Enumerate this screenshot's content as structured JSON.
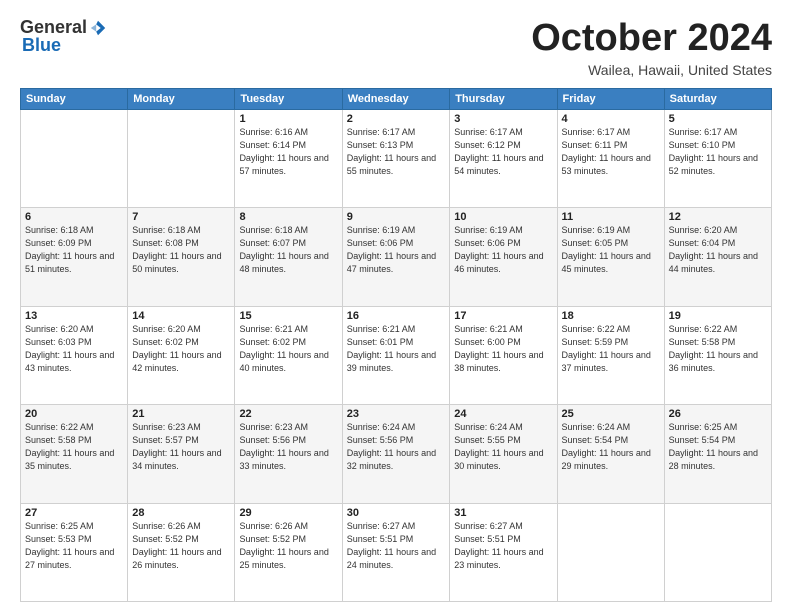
{
  "header": {
    "logo_general": "General",
    "logo_blue": "Blue",
    "month_title": "October 2024",
    "location": "Wailea, Hawaii, United States"
  },
  "calendar": {
    "days_of_week": [
      "Sunday",
      "Monday",
      "Tuesday",
      "Wednesday",
      "Thursday",
      "Friday",
      "Saturday"
    ],
    "weeks": [
      [
        {
          "day": "",
          "sunrise": "",
          "sunset": "",
          "daylight": ""
        },
        {
          "day": "",
          "sunrise": "",
          "sunset": "",
          "daylight": ""
        },
        {
          "day": "1",
          "sunrise": "Sunrise: 6:16 AM",
          "sunset": "Sunset: 6:14 PM",
          "daylight": "Daylight: 11 hours and 57 minutes."
        },
        {
          "day": "2",
          "sunrise": "Sunrise: 6:17 AM",
          "sunset": "Sunset: 6:13 PM",
          "daylight": "Daylight: 11 hours and 55 minutes."
        },
        {
          "day": "3",
          "sunrise": "Sunrise: 6:17 AM",
          "sunset": "Sunset: 6:12 PM",
          "daylight": "Daylight: 11 hours and 54 minutes."
        },
        {
          "day": "4",
          "sunrise": "Sunrise: 6:17 AM",
          "sunset": "Sunset: 6:11 PM",
          "daylight": "Daylight: 11 hours and 53 minutes."
        },
        {
          "day": "5",
          "sunrise": "Sunrise: 6:17 AM",
          "sunset": "Sunset: 6:10 PM",
          "daylight": "Daylight: 11 hours and 52 minutes."
        }
      ],
      [
        {
          "day": "6",
          "sunrise": "Sunrise: 6:18 AM",
          "sunset": "Sunset: 6:09 PM",
          "daylight": "Daylight: 11 hours and 51 minutes."
        },
        {
          "day": "7",
          "sunrise": "Sunrise: 6:18 AM",
          "sunset": "Sunset: 6:08 PM",
          "daylight": "Daylight: 11 hours and 50 minutes."
        },
        {
          "day": "8",
          "sunrise": "Sunrise: 6:18 AM",
          "sunset": "Sunset: 6:07 PM",
          "daylight": "Daylight: 11 hours and 48 minutes."
        },
        {
          "day": "9",
          "sunrise": "Sunrise: 6:19 AM",
          "sunset": "Sunset: 6:06 PM",
          "daylight": "Daylight: 11 hours and 47 minutes."
        },
        {
          "day": "10",
          "sunrise": "Sunrise: 6:19 AM",
          "sunset": "Sunset: 6:06 PM",
          "daylight": "Daylight: 11 hours and 46 minutes."
        },
        {
          "day": "11",
          "sunrise": "Sunrise: 6:19 AM",
          "sunset": "Sunset: 6:05 PM",
          "daylight": "Daylight: 11 hours and 45 minutes."
        },
        {
          "day": "12",
          "sunrise": "Sunrise: 6:20 AM",
          "sunset": "Sunset: 6:04 PM",
          "daylight": "Daylight: 11 hours and 44 minutes."
        }
      ],
      [
        {
          "day": "13",
          "sunrise": "Sunrise: 6:20 AM",
          "sunset": "Sunset: 6:03 PM",
          "daylight": "Daylight: 11 hours and 43 minutes."
        },
        {
          "day": "14",
          "sunrise": "Sunrise: 6:20 AM",
          "sunset": "Sunset: 6:02 PM",
          "daylight": "Daylight: 11 hours and 42 minutes."
        },
        {
          "day": "15",
          "sunrise": "Sunrise: 6:21 AM",
          "sunset": "Sunset: 6:02 PM",
          "daylight": "Daylight: 11 hours and 40 minutes."
        },
        {
          "day": "16",
          "sunrise": "Sunrise: 6:21 AM",
          "sunset": "Sunset: 6:01 PM",
          "daylight": "Daylight: 11 hours and 39 minutes."
        },
        {
          "day": "17",
          "sunrise": "Sunrise: 6:21 AM",
          "sunset": "Sunset: 6:00 PM",
          "daylight": "Daylight: 11 hours and 38 minutes."
        },
        {
          "day": "18",
          "sunrise": "Sunrise: 6:22 AM",
          "sunset": "Sunset: 5:59 PM",
          "daylight": "Daylight: 11 hours and 37 minutes."
        },
        {
          "day": "19",
          "sunrise": "Sunrise: 6:22 AM",
          "sunset": "Sunset: 5:58 PM",
          "daylight": "Daylight: 11 hours and 36 minutes."
        }
      ],
      [
        {
          "day": "20",
          "sunrise": "Sunrise: 6:22 AM",
          "sunset": "Sunset: 5:58 PM",
          "daylight": "Daylight: 11 hours and 35 minutes."
        },
        {
          "day": "21",
          "sunrise": "Sunrise: 6:23 AM",
          "sunset": "Sunset: 5:57 PM",
          "daylight": "Daylight: 11 hours and 34 minutes."
        },
        {
          "day": "22",
          "sunrise": "Sunrise: 6:23 AM",
          "sunset": "Sunset: 5:56 PM",
          "daylight": "Daylight: 11 hours and 33 minutes."
        },
        {
          "day": "23",
          "sunrise": "Sunrise: 6:24 AM",
          "sunset": "Sunset: 5:56 PM",
          "daylight": "Daylight: 11 hours and 32 minutes."
        },
        {
          "day": "24",
          "sunrise": "Sunrise: 6:24 AM",
          "sunset": "Sunset: 5:55 PM",
          "daylight": "Daylight: 11 hours and 30 minutes."
        },
        {
          "day": "25",
          "sunrise": "Sunrise: 6:24 AM",
          "sunset": "Sunset: 5:54 PM",
          "daylight": "Daylight: 11 hours and 29 minutes."
        },
        {
          "day": "26",
          "sunrise": "Sunrise: 6:25 AM",
          "sunset": "Sunset: 5:54 PM",
          "daylight": "Daylight: 11 hours and 28 minutes."
        }
      ],
      [
        {
          "day": "27",
          "sunrise": "Sunrise: 6:25 AM",
          "sunset": "Sunset: 5:53 PM",
          "daylight": "Daylight: 11 hours and 27 minutes."
        },
        {
          "day": "28",
          "sunrise": "Sunrise: 6:26 AM",
          "sunset": "Sunset: 5:52 PM",
          "daylight": "Daylight: 11 hours and 26 minutes."
        },
        {
          "day": "29",
          "sunrise": "Sunrise: 6:26 AM",
          "sunset": "Sunset: 5:52 PM",
          "daylight": "Daylight: 11 hours and 25 minutes."
        },
        {
          "day": "30",
          "sunrise": "Sunrise: 6:27 AM",
          "sunset": "Sunset: 5:51 PM",
          "daylight": "Daylight: 11 hours and 24 minutes."
        },
        {
          "day": "31",
          "sunrise": "Sunrise: 6:27 AM",
          "sunset": "Sunset: 5:51 PM",
          "daylight": "Daylight: 11 hours and 23 minutes."
        },
        {
          "day": "",
          "sunrise": "",
          "sunset": "",
          "daylight": ""
        },
        {
          "day": "",
          "sunrise": "",
          "sunset": "",
          "daylight": ""
        }
      ]
    ]
  }
}
